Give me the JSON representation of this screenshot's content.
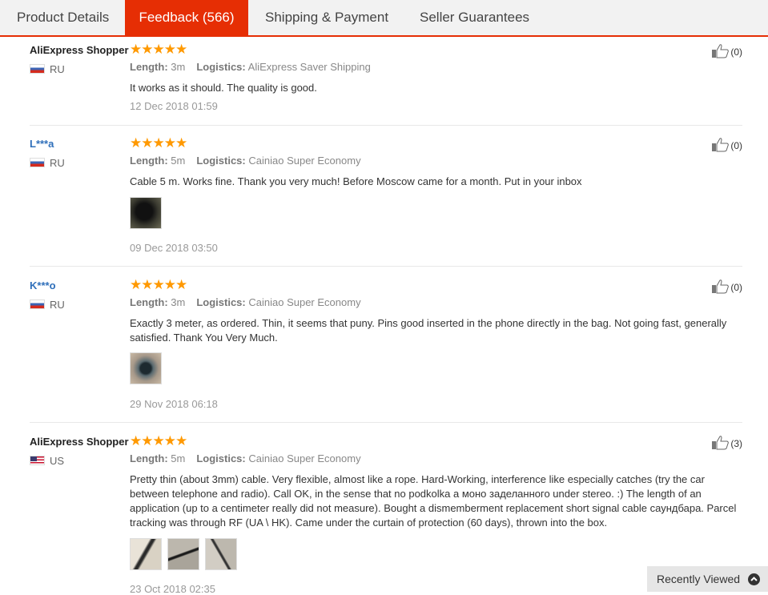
{
  "tabs": [
    {
      "label": "Product Details"
    },
    {
      "label": "Feedback (566)"
    },
    {
      "label": "Shipping & Payment"
    },
    {
      "label": "Seller Guarantees"
    }
  ],
  "labels": {
    "length": "Length:",
    "logistics": "Logistics:"
  },
  "reviews": [
    {
      "user": "AliExpress Shopper",
      "country": "RU",
      "stars": "★★★★★",
      "length": "3m",
      "logistics": "AliExpress Saver Shipping",
      "text": "It works as it should. The quality is good.",
      "date": "12 Dec 2018 01:59",
      "likes": "(0)"
    },
    {
      "user": "L***a",
      "country": "RU",
      "stars": "★★★★★",
      "length": "5m",
      "logistics": "Cainiao Super Economy",
      "text": "Cable 5 m. Works fine. Thank you very much! Before Moscow came for a month. Put in your inbox",
      "date": "09 Dec 2018 03:50",
      "likes": "(0)"
    },
    {
      "user": "K***o",
      "country": "RU",
      "stars": "★★★★★",
      "length": "3m",
      "logistics": "Cainiao Super Economy",
      "text": "Exactly 3 meter, as ordered. Thin, it seems that puny. Pins good inserted in the phone directly in the bag. Not going fast, generally satisfied. Thank You Very Much.",
      "date": "29 Nov 2018 06:18",
      "likes": "(0)"
    },
    {
      "user": "AliExpress Shopper",
      "country": "US",
      "stars": "★★★★★",
      "length": "5m",
      "logistics": "Cainiao Super Economy",
      "text": "Pretty thin (about 3mm) cable. Very flexible, almost like a rope. Hard-Working, interference like especially catches (try the car between telephone and radio). Call OK, in the sense that no podkolka a моно заделанного under stereo. :) The length of an application (up to a centimeter really did not measure). Bought a dismemberment replacement short signal cable саундбара. Parcel tracking was through RF (UA \\ HK). Came under the curtain of protection (60 days), thrown into the box.",
      "date": "23 Oct 2018 02:35",
      "likes": "(3)"
    }
  ],
  "recently_viewed": "Recently Viewed",
  "colors": {
    "accent": "#e62e04",
    "star": "#ff9900",
    "link": "#2f6fba"
  }
}
